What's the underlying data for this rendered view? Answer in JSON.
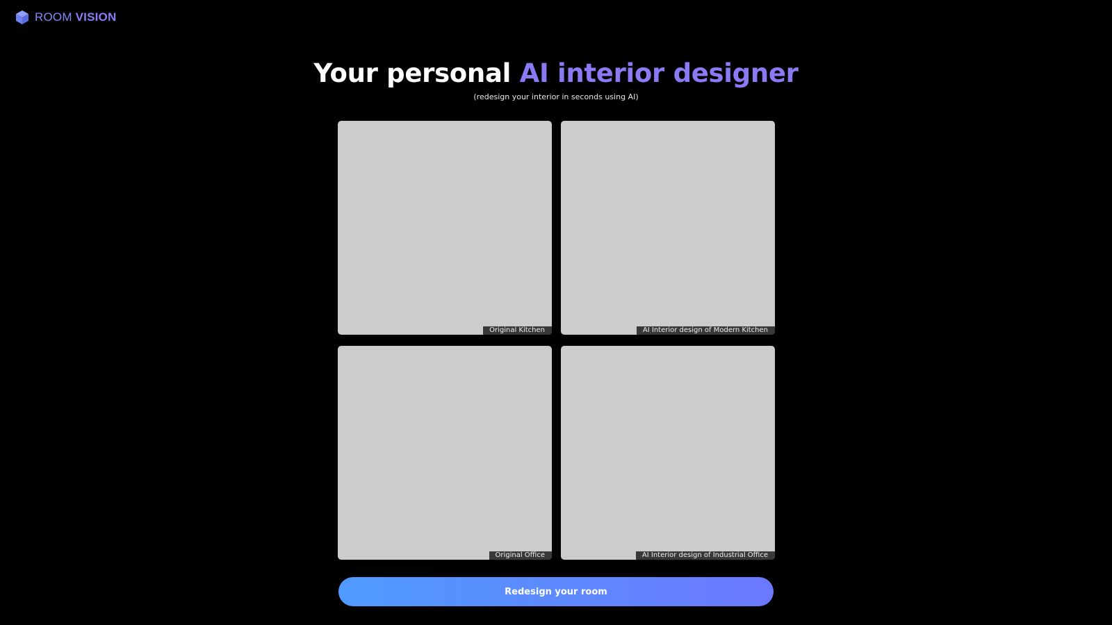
{
  "app": {
    "logo_light": "ROOM",
    "logo_bold": "VISION",
    "logo_icon": "cube-icon",
    "brand_color": "#7c8cf2"
  },
  "hero": {
    "title_plain": "Your personal",
    "title_accent": "AI interior designer",
    "subtitle": "(redesign your interior in seconds using AI)",
    "accent_color": "#8a7af4"
  },
  "gallery": [
    {
      "caption": "Original Kitchen"
    },
    {
      "caption": "AI Interior design of Modern Kitchen"
    },
    {
      "caption": "Original Office"
    },
    {
      "caption": "AI Interior design of Industrial Office"
    }
  ],
  "cta": {
    "label": "Redesign your room",
    "gradient_start": "#4f9bff",
    "gradient_end": "#6b78ff"
  }
}
